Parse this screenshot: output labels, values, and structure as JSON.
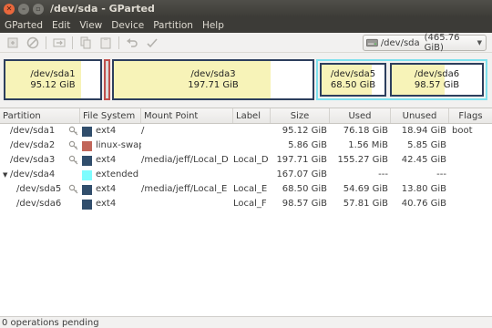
{
  "window": {
    "title": "/dev/sda - GParted"
  },
  "menu": [
    "GParted",
    "Edit",
    "View",
    "Device",
    "Partition",
    "Help"
  ],
  "toolbar": {
    "device_label": "/dev/sda",
    "device_size": "(465.76 GiB)"
  },
  "diskmap": {
    "sda1": {
      "name": "/dev/sda1",
      "size": "95.12 GiB",
      "used_fraction": 0.8
    },
    "sda3": {
      "name": "/dev/sda3",
      "size": "197.71 GiB",
      "used_fraction": 0.79
    },
    "sda5": {
      "name": "/dev/sda5",
      "size": "68.50 GiB",
      "used_fraction": 0.8
    },
    "sda6": {
      "name": "/dev/sda6",
      "size": "98.57 GiB",
      "used_fraction": 0.59
    }
  },
  "table": {
    "headers": [
      "Partition",
      "File System",
      "Mount Point",
      "Label",
      "Size",
      "Used",
      "Unused",
      "Flags"
    ],
    "rows": [
      {
        "partition": "/dev/sda1",
        "fs": "ext4",
        "fs_color": "#314e6c",
        "mount": "/",
        "label": "",
        "size": "95.12 GiB",
        "used": "76.18 GiB",
        "unused": "18.94 GiB",
        "flags": "boot",
        "key": true
      },
      {
        "partition": "/dev/sda2",
        "fs": "linux-swap",
        "fs_color": "#c1665a",
        "mount": "",
        "label": "",
        "size": "5.86 GiB",
        "used": "1.56 MiB",
        "unused": "5.85 GiB",
        "flags": "",
        "key": true
      },
      {
        "partition": "/dev/sda3",
        "fs": "ext4",
        "fs_color": "#314e6c",
        "mount": "/media/jeff/Local_D",
        "label": "Local_D",
        "size": "197.71 GiB",
        "used": "155.27 GiB",
        "unused": "42.45 GiB",
        "flags": "",
        "key": true
      },
      {
        "partition": "/dev/sda4",
        "fs": "extended",
        "fs_color": "#7dfcfe",
        "mount": "",
        "label": "",
        "size": "167.07 GiB",
        "used": "---",
        "unused": "---",
        "flags": "",
        "key": false
      },
      {
        "partition": "/dev/sda5",
        "fs": "ext4",
        "fs_color": "#314e6c",
        "mount": "/media/jeff/Local_E",
        "label": "Local_E",
        "size": "68.50 GiB",
        "used": "54.69 GiB",
        "unused": "13.80 GiB",
        "flags": "",
        "key": true
      },
      {
        "partition": "/dev/sda6",
        "fs": "ext4",
        "fs_color": "#314e6c",
        "mount": "",
        "label": "Local_F",
        "size": "98.57 GiB",
        "used": "57.81 GiB",
        "unused": "40.76 GiB",
        "flags": "",
        "key": false
      }
    ]
  },
  "status": {
    "text": "0 operations pending"
  },
  "icons": [
    "close-icon",
    "minimize-icon",
    "maximize-icon",
    "new-icon",
    "delete-icon",
    "resize-move-icon",
    "copy-icon",
    "paste-icon",
    "undo-icon",
    "apply-icon",
    "harddisk-icon",
    "key-icon"
  ]
}
